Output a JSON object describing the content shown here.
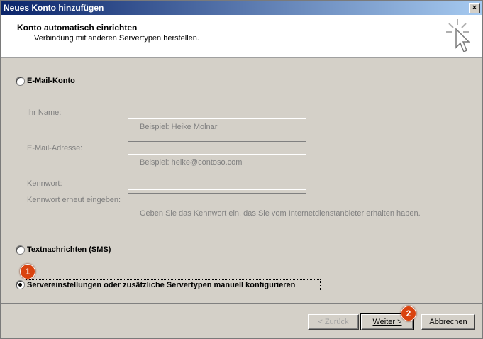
{
  "window": {
    "title": "Neues Konto hinzufügen",
    "close": "×"
  },
  "header": {
    "title": "Konto automatisch einrichten",
    "subtitle": "Verbindung mit anderen Servertypen herstellen."
  },
  "options": {
    "email": "E-Mail-Konto",
    "sms": "Textnachrichten (SMS)",
    "manual": "Servereinstellungen oder zusätzliche Servertypen manuell konfigurieren"
  },
  "form": {
    "name_label": "Ihr Name:",
    "name_hint": "Beispiel: Heike Molnar",
    "email_label": "E-Mail-Adresse:",
    "email_hint": "Beispiel: heike@contoso.com",
    "password_label": "Kennwort:",
    "password2_label": "Kennwort erneut eingeben:",
    "password_hint": "Geben Sie das Kennwort ein, das Sie vom Internetdienstanbieter erhalten haben."
  },
  "buttons": {
    "back": "< Zurück",
    "next": "Weiter >",
    "cancel": "Abbrechen"
  },
  "badges": {
    "one": "1",
    "two": "2"
  }
}
